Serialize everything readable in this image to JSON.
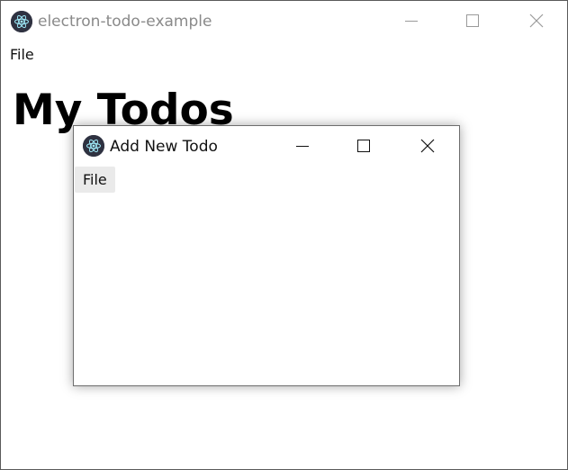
{
  "main_window": {
    "title": "electron-todo-example",
    "menu": [
      "File"
    ],
    "heading": "My Todos",
    "title_color": "#8a8a8a",
    "app_icon": "electron-icon",
    "controls": [
      "minimize-icon",
      "maximize-icon",
      "close-icon"
    ]
  },
  "child_window": {
    "title": "Add New Todo",
    "menu": [
      "File"
    ],
    "title_color": "#111111",
    "app_icon": "electron-icon",
    "controls": [
      "minimize-icon",
      "maximize-icon",
      "close-icon"
    ]
  }
}
